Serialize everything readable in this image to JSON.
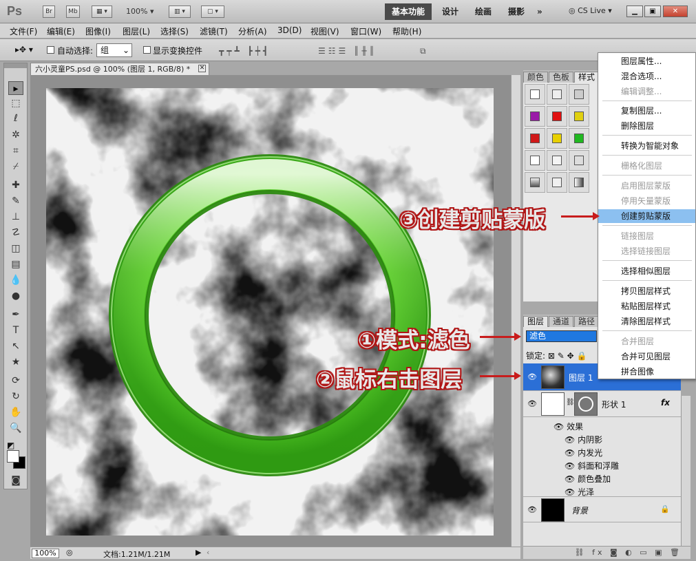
{
  "app": {
    "logo": "Ps",
    "br_label": "Br",
    "mb_label": "Mb",
    "zoom": "100%",
    "cslive": "CS Live"
  },
  "workspace": {
    "active": "基本功能",
    "tabs": [
      "设计",
      "绘画",
      "摄影",
      "»"
    ]
  },
  "menubar": [
    "文件(F)",
    "编辑(E)",
    "图像(I)",
    "图层(L)",
    "选择(S)",
    "滤镜(T)",
    "分析(A)",
    "3D(D)",
    "视图(V)",
    "窗口(W)",
    "帮助(H)"
  ],
  "options": {
    "auto_select_label": "自动选择:",
    "auto_select_value": "组",
    "show_transform_label": "显示变换控件"
  },
  "document": {
    "tab_title": "六小灵童PS.psd @ 100% (图层 1, RGB/8) *",
    "zoom": "100%",
    "info": "文档:1.21M/1.21M"
  },
  "top_panel": {
    "tabs": [
      "颜色",
      "色板",
      "样式"
    ]
  },
  "layers_panel": {
    "tabs": [
      "图层",
      "通道",
      "路径"
    ],
    "blend_mode": "滤色",
    "lock_label": "锁定:",
    "layers": [
      {
        "name": "图层 1",
        "selected": true
      },
      {
        "name": "形状 1",
        "fx": "fx"
      },
      {
        "name": "背景"
      }
    ],
    "effects_label": "效果",
    "effects": [
      "内阴影",
      "内发光",
      "斜面和浮雕",
      "颜色叠加",
      "光泽"
    ]
  },
  "context_menu": [
    {
      "label": "图层属性...",
      "disabled": false
    },
    {
      "label": "混合选项...",
      "disabled": false
    },
    {
      "label": "编辑调整...",
      "disabled": true
    },
    {
      "label": "复制图层...",
      "disabled": false
    },
    {
      "label": "删除图层",
      "disabled": false
    },
    {
      "label": "转换为智能对象",
      "disabled": false
    },
    {
      "label": "栅格化图层",
      "disabled": true
    },
    {
      "label": "启用图层蒙版",
      "disabled": true
    },
    {
      "label": "停用矢量蒙版",
      "disabled": true
    },
    {
      "label": "创建剪贴蒙版",
      "disabled": false,
      "highlighted": true
    },
    {
      "label": "链接图层",
      "disabled": true
    },
    {
      "label": "选择链接图层",
      "disabled": true
    },
    {
      "label": "选择相似图层",
      "disabled": false
    },
    {
      "label": "拷贝图层样式",
      "disabled": false
    },
    {
      "label": "粘贴图层样式",
      "disabled": false
    },
    {
      "label": "清除图层样式",
      "disabled": false
    },
    {
      "label": "合并图层",
      "disabled": true
    },
    {
      "label": "合并可见图层",
      "disabled": false
    },
    {
      "label": "拼合图像",
      "disabled": false
    }
  ],
  "annotations": {
    "step1": "①模式:滤色",
    "step2": "②鼠标右击图层",
    "step3": "③创建剪贴蒙版"
  },
  "colors": {
    "selection_blue": "#2b6fd6",
    "ring_green": "#5ad02a",
    "annotation_red": "#c81c1c"
  }
}
